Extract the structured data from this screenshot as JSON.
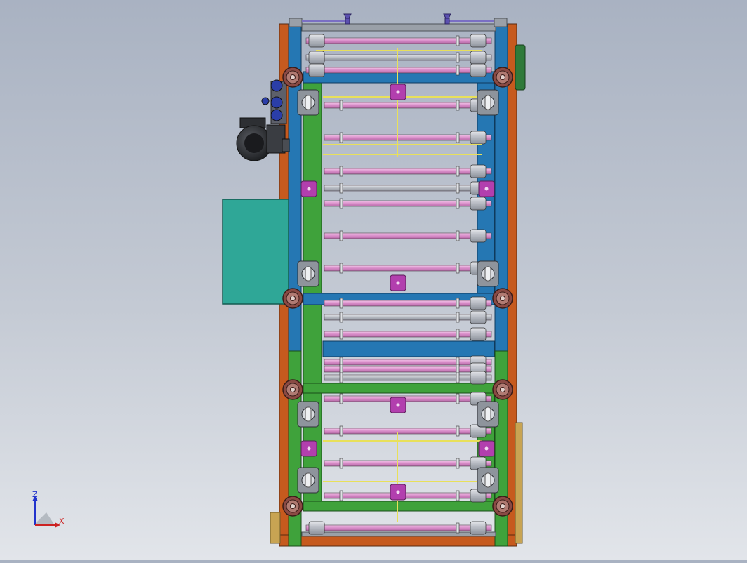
{
  "viewport": {
    "triad": {
      "z_label": "Z",
      "x_label": "X"
    }
  },
  "colors": {
    "frame_orange": "#c65a1e",
    "frame_blue": "#2577b3",
    "frame_green": "#3fa23b",
    "roller_pink": "#e6a4d6",
    "roller_gray": "#b8bcc4",
    "bracket_magenta": "#b23fae",
    "rod_yellow": "#e8e05a",
    "cabinet_teal": "#2fa797",
    "motor_dark": "#2d2f33",
    "wheel_brown": "#8a4a44",
    "cover_green_dark": "#2f7a3a",
    "handle_purple": "#7a6fc4"
  }
}
